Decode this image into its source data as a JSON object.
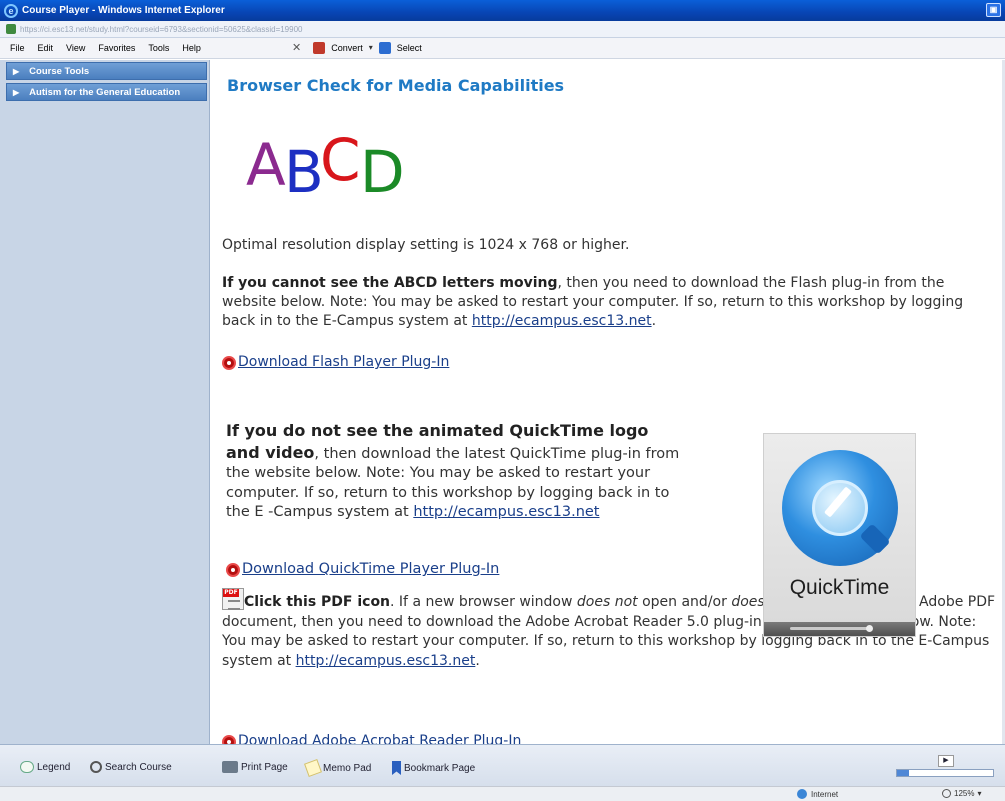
{
  "window": {
    "title": "Course Player - Windows Internet Explorer",
    "address": "https://ci.esc13.net/study.html?courseid=6793&sectionid=50625&classid=19900"
  },
  "menubar": {
    "items": [
      "File",
      "Edit",
      "View",
      "Favorites",
      "Tools",
      "Help"
    ],
    "convert_label": "Convert",
    "select_label": "Select"
  },
  "sidebar": {
    "items": [
      {
        "label": "Course Tools"
      },
      {
        "label": "Autism for the General Education"
      }
    ]
  },
  "main": {
    "title": "Browser Check for Media Capabilities",
    "abcd": [
      "A",
      "B",
      "C",
      "D"
    ],
    "resolution_text": "Optimal resolution display setting is 1024 x 768 or higher.",
    "flash": {
      "bold": "If you cannot see the ABCD letters moving",
      "text": ", then you need to download the Flash plug-in from the website below. Note: You may be asked to restart your computer. If so, return to this workshop by logging back in to the E-Campus system at ",
      "link": "http://ecampus.esc13.net",
      "end": ".",
      "download_label": "Download Flash Player Plug-In"
    },
    "quicktime": {
      "bold": "If you do not see the animated QuickTime logo and video",
      "text": ", then download the latest QuickTime plug-in from the website below. Note: You may be asked to restart your computer. If so, return to this workshop by logging back in to the E -Campus system at ",
      "link": "http://ecampus.esc13.net",
      "download_label": "Download QuickTime Player Plug-In",
      "logo_word": "QuickTime"
    },
    "pdf": {
      "bold": "Click this PDF icon",
      "t1": ". If a new browser window ",
      "i1": "does not",
      "t2": " open and/or ",
      "i2": "does not",
      "t3": " display a sample Adobe PDF document, then you need to download the Adobe Acrobat Reader 5.0 plug-in from the website below. Note: You may be asked to restart your computer. If so, return to this workshop by logging back in to the E-Campus system at ",
      "link": "http://ecampus.esc13.net",
      "end": ".",
      "download_label": "Download Adobe Acrobat Reader Plug-In"
    }
  },
  "bottombar": {
    "legend": "Legend",
    "search": "Search Course",
    "print": "Print Page",
    "memo": "Memo Pad",
    "bookmark": "Bookmark Page"
  },
  "statusbar": {
    "zone": "Internet",
    "zoom": "125%"
  },
  "colors": {
    "title_blue": "#1f7ac4",
    "link": "#1a3f8a",
    "sidebar_bg": "#c8d5e6",
    "sidebar_item": "#5a8cc9"
  }
}
